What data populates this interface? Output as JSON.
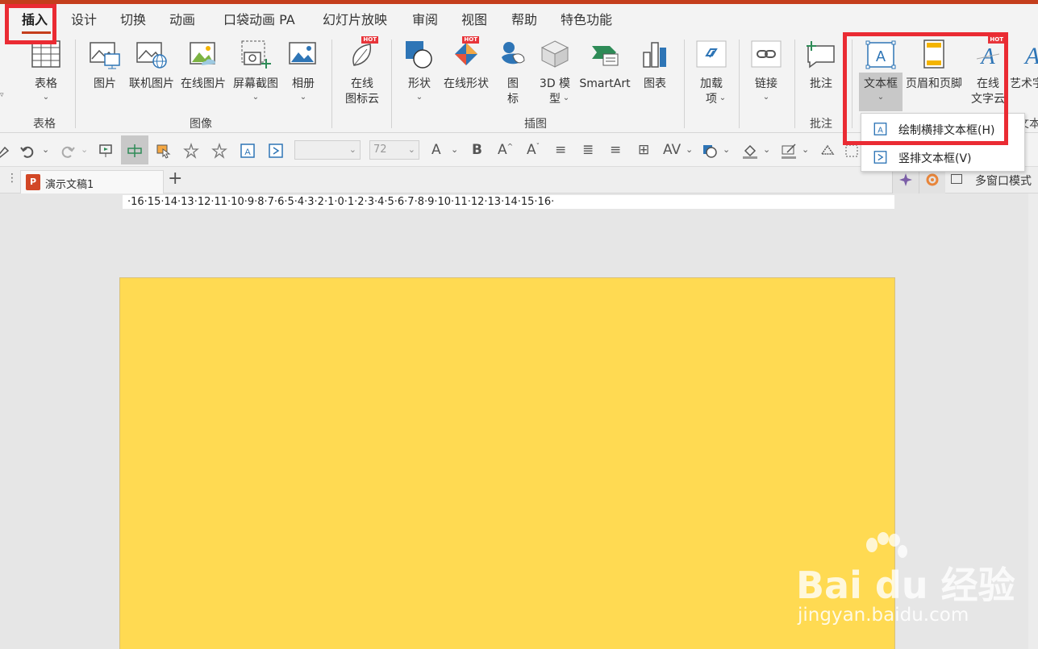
{
  "tabs": {
    "items": [
      "插入",
      "设计",
      "切换",
      "动画",
      "口袋动画 PA",
      "幻灯片放映",
      "审阅",
      "视图",
      "帮助",
      "特色功能"
    ],
    "active": "插入"
  },
  "ribbon": {
    "table": {
      "label": "表格",
      "group": "表格"
    },
    "image_group": "图像",
    "picture": "图片",
    "online_picture": "联机图片",
    "web_picture": "在线图片",
    "screenshot": "屏幕截图",
    "album": "相册",
    "icon_cloud": {
      "line1": "在线",
      "line2": "图标云",
      "badge": "HOT"
    },
    "illust_group": "插图",
    "shapes": "形状",
    "online_shapes": {
      "label": "在线形状",
      "badge": "HOT"
    },
    "icons": {
      "line1": "图",
      "line2": "标"
    },
    "model3d": {
      "line1": "3D 模",
      "line2": "型"
    },
    "smartart": "SmartArt",
    "chart": "图表",
    "addins": {
      "line1": "加载",
      "line2": "项"
    },
    "link": "链接",
    "comment": "批注",
    "comment_group": "批注",
    "textbox": "文本框",
    "header_footer": "页眉和页脚",
    "online_text": {
      "line1": "在线",
      "line2": "文字云",
      "badge": "HOT"
    },
    "wordart": "艺术字",
    "text_group_partial": "文本"
  },
  "quickbar": {
    "font_name": "",
    "font_size": "72"
  },
  "docbar": {
    "doc_name": "演示文稿1",
    "multi_window": "多窗口模式"
  },
  "ruler": {
    "text": "·16·15·14·13·12·11·10·9·8·7·6·5·4·3·2·1·0·1·2·3·4·5·6·7·8·9·10·11·12·13·14·15·16·"
  },
  "menu": {
    "horizontal": "绘制横排文本框(H)",
    "vertical": "竖排文本框(V)"
  },
  "watermark": {
    "main": "Bai du 经验",
    "sub": "jingyan.baidu.com"
  },
  "colors": {
    "slide": "#ffda52",
    "highlight": "#ea2b33",
    "accent": "#c43e1c",
    "icon_blue": "#2e75b6"
  }
}
